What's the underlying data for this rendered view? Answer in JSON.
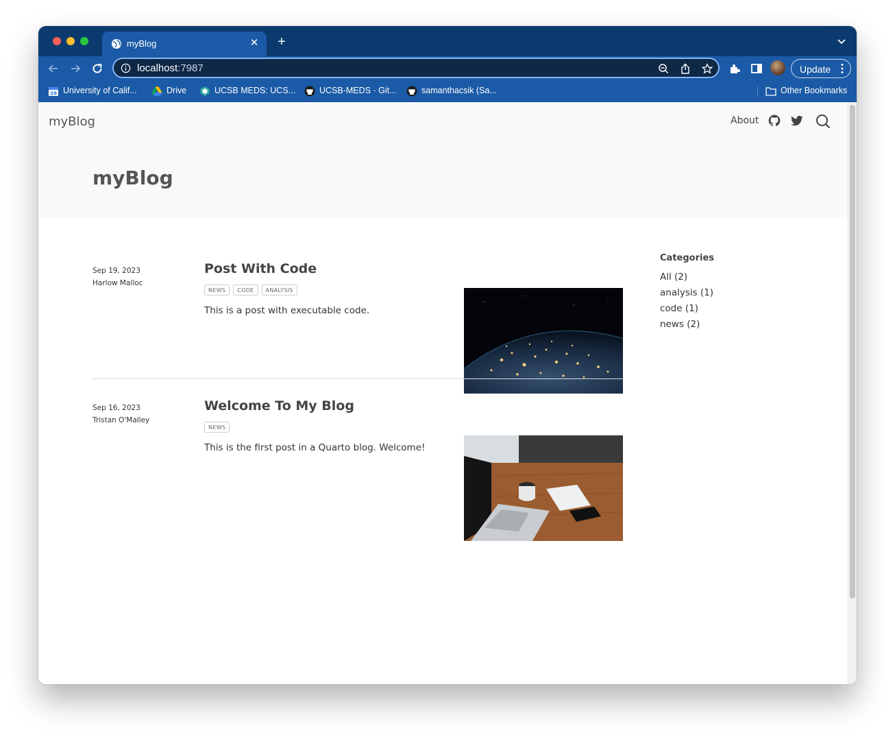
{
  "browser": {
    "tab": {
      "title": "myBlog",
      "close": "✕"
    },
    "new_tab": "+",
    "address": {
      "host": "localhost",
      "port": ":7987"
    },
    "update_button": "Update",
    "bookmarks": [
      {
        "label": "University of Calif...",
        "icon": "calendar-icon"
      },
      {
        "label": "Drive",
        "icon": "drive-icon"
      },
      {
        "label": "UCSB MEDS: UCS...",
        "icon": "meds-icon"
      },
      {
        "label": "UCSB-MEDS · Git...",
        "icon": "github-icon"
      },
      {
        "label": "samanthacsik (Sa...",
        "icon": "github-icon"
      }
    ],
    "other_bookmarks": "Other Bookmarks",
    "colors": {
      "tabstrip": "#0b3a6e",
      "toolbar": "#1b5aa6",
      "omnibox": "#0e2846"
    }
  },
  "site": {
    "brand": "myBlog",
    "nav": {
      "about": "About"
    },
    "hero_title": "myBlog",
    "posts": [
      {
        "date": "Sep 19, 2023",
        "author": "Harlow Malloc",
        "title": "Post With Code",
        "tags": [
          "NEWS",
          "CODE",
          "ANALYSIS"
        ],
        "description": "This is a post with executable code.",
        "image": "earth-at-night"
      },
      {
        "date": "Sep 16, 2023",
        "author": "Tristan O'Malley",
        "title": "Welcome To My Blog",
        "tags": [
          "NEWS"
        ],
        "description": "This is the first post in a Quarto blog. Welcome!",
        "image": "laptop-on-desk"
      }
    ],
    "categories": {
      "heading": "Categories",
      "items": [
        "All (2)",
        "analysis (1)",
        "code (1)",
        "news (2)"
      ]
    }
  }
}
